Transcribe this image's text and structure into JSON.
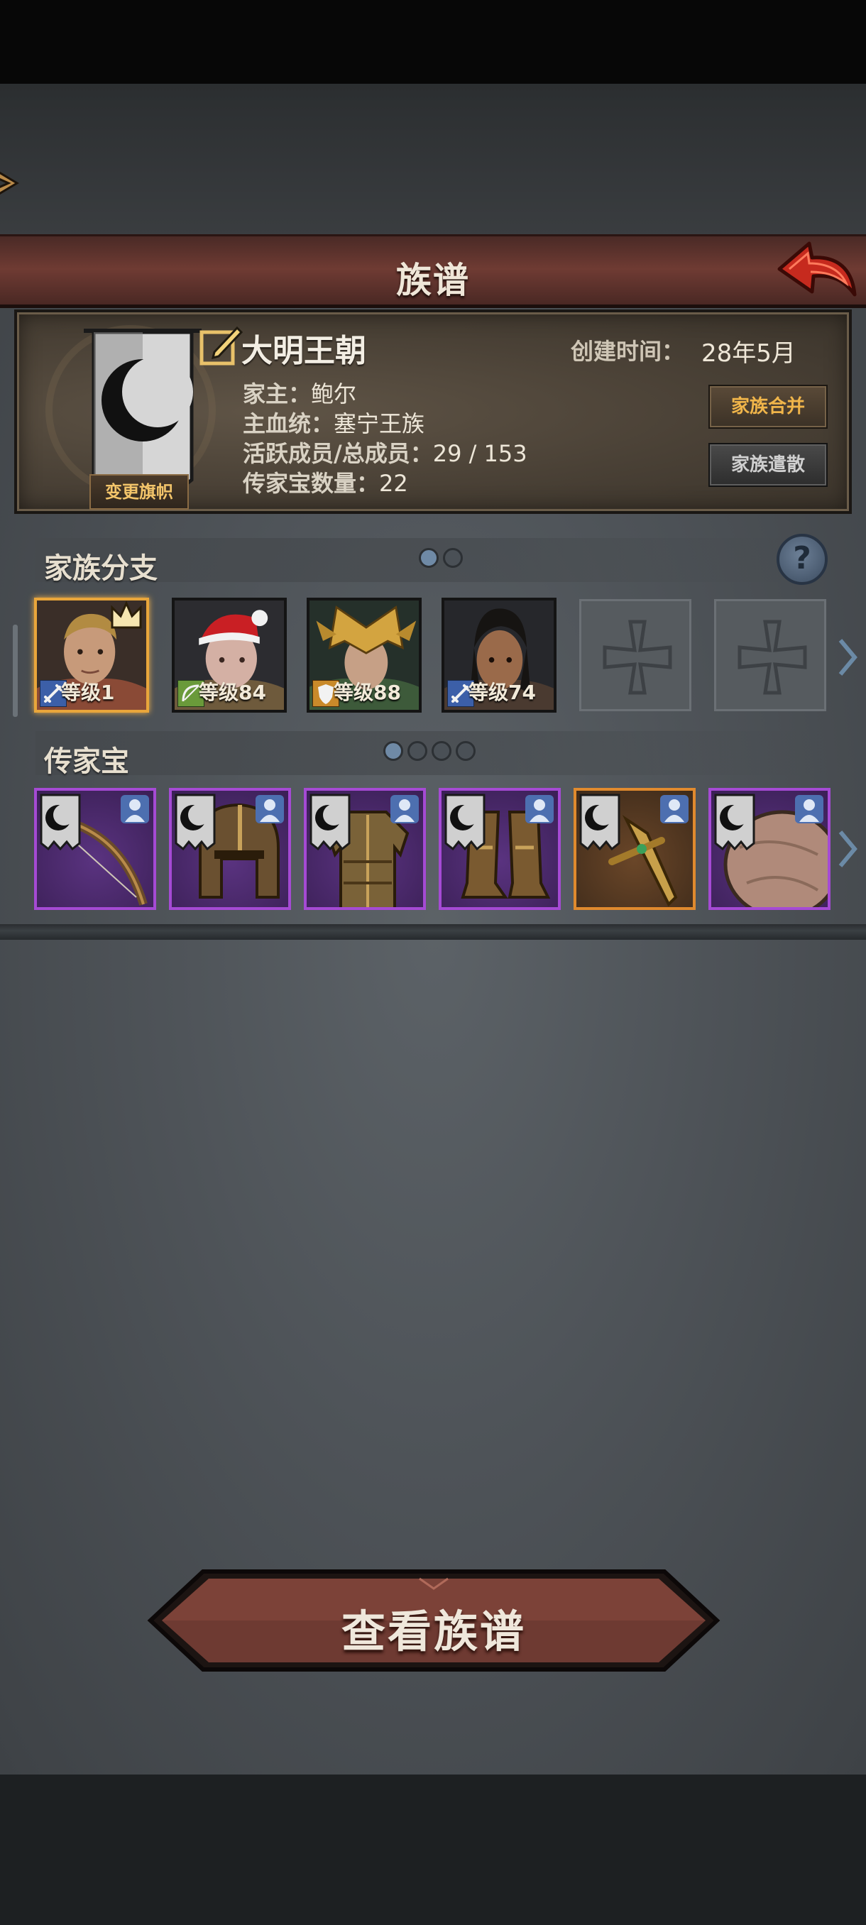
{
  "header": {
    "title": "族谱"
  },
  "family": {
    "name": "大明王朝",
    "created_label": "创建时间：",
    "created_value": "28年5月",
    "head_label": "家主：",
    "head_value": "鲍尔",
    "bloodline_label": "主血统：",
    "bloodline_value": "塞宁王族",
    "members_label": "活跃成员/总成员：",
    "members_value": "29 / 153",
    "heirloom_count_label": "传家宝数量：",
    "heirloom_count_value": "22",
    "change_flag_label": "变更旗帜",
    "merge_label": "家族合并",
    "dissolve_label": "家族遣散"
  },
  "branches": {
    "title": "家族分支",
    "page_count": 2,
    "active_page": 1,
    "members": [
      {
        "level": "等级1",
        "class_icon": "sword-icon",
        "leader": true
      },
      {
        "level": "等级84",
        "class_icon": "bow-icon",
        "leader": false
      },
      {
        "level": "等级88",
        "class_icon": "shield-icon",
        "leader": false
      },
      {
        "level": "等级74",
        "class_icon": "sword-icon",
        "leader": false
      }
    ],
    "empty_slots": 2
  },
  "heirlooms": {
    "title": "传家宝",
    "page_count": 4,
    "active_page": 1,
    "items": [
      {
        "item": "bow-icon",
        "rarity": "epic"
      },
      {
        "item": "helmet-icon",
        "rarity": "epic"
      },
      {
        "item": "armor-icon",
        "rarity": "epic"
      },
      {
        "item": "greaves-icon",
        "rarity": "epic"
      },
      {
        "item": "dagger-icon",
        "rarity": "legendary"
      },
      {
        "item": "shield-icon",
        "rarity": "epic"
      }
    ]
  },
  "actions": {
    "view_tree_label": "查看族谱"
  },
  "colors": {
    "epic": "#a54ad4",
    "legendary": "#e08a2e",
    "leader_frame": "#e9a63b",
    "title_banner": "#6f3b33"
  }
}
